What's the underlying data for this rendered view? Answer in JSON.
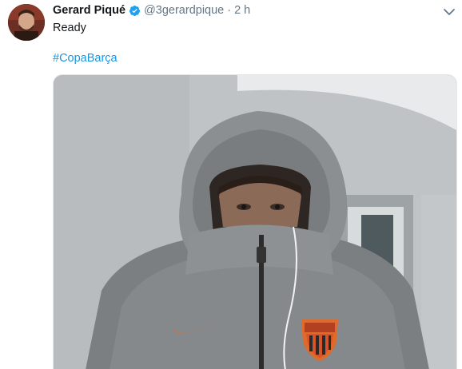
{
  "tweet": {
    "author_name": "Gerard Piqué",
    "author_handle": "@3gerardpique",
    "separator": "·",
    "timestamp": "2 h",
    "text": "Ready",
    "hashtag": "#CopaBarça"
  },
  "icons": {
    "verified": "verified-badge-icon",
    "menu": "chevron-down-icon"
  },
  "colors": {
    "name": "#14171a",
    "secondary": "#657786",
    "link": "#1b95e0",
    "verified": "#1da1f2"
  }
}
